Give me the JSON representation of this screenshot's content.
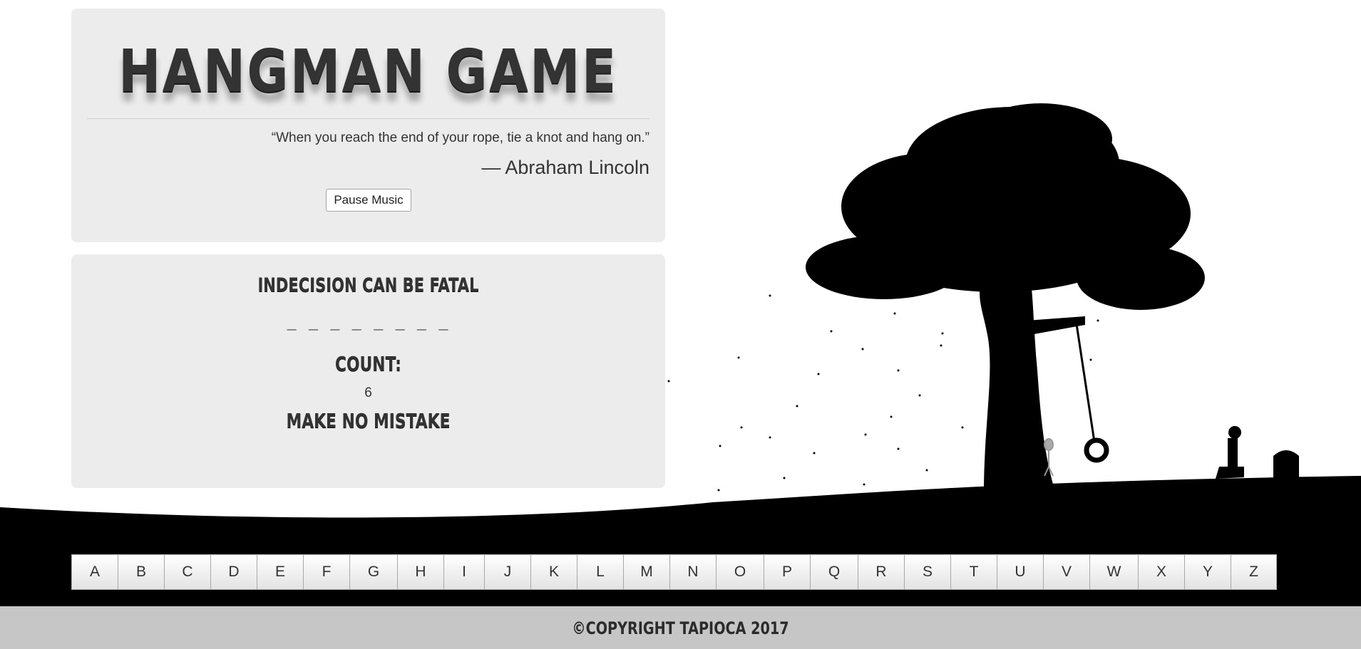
{
  "header": {
    "title": "HANGMAN GAME",
    "quote": "“When you reach the end of your rope, tie a knot and hang on.”",
    "author": "— Abraham Lincoln",
    "pause_label": "Pause Music"
  },
  "game": {
    "hint": "INDECISION CAN BE FATAL",
    "word_slots": "_ _ _ _ _ _ _ _",
    "count_label": "COUNT:",
    "count_value": "6",
    "warning": "MAKE NO MISTAKE"
  },
  "keyboard": {
    "letters": [
      "A",
      "B",
      "C",
      "D",
      "E",
      "F",
      "G",
      "H",
      "I",
      "J",
      "K",
      "L",
      "M",
      "N",
      "O",
      "P",
      "Q",
      "R",
      "S",
      "T",
      "U",
      "V",
      "W",
      "X",
      "Y",
      "Z"
    ]
  },
  "footer": {
    "copyright": "©COPYRIGHT TAPIOCA 2017"
  },
  "colors": {
    "panel": "#ececec",
    "silhouette": "#000000",
    "footer": "#c6c6c6"
  }
}
